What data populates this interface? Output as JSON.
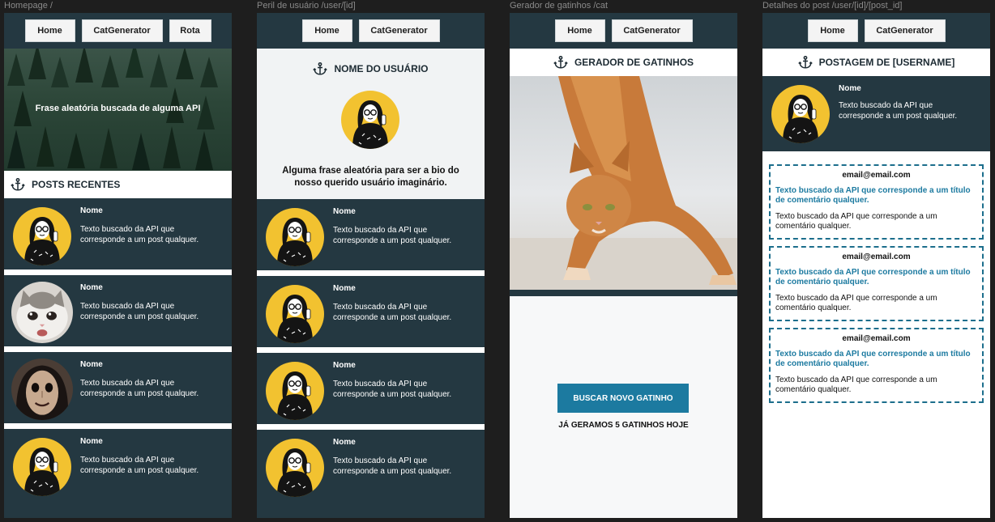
{
  "frames": {
    "home": {
      "label": "Homepage /"
    },
    "profile": {
      "label": "Peril de usuário /user/[id]"
    },
    "cat": {
      "label": "Gerador de gatinhos /cat"
    },
    "detail": {
      "label": "Detalhes do post /user/[id]/[post_id]"
    }
  },
  "nav": {
    "home": "Home",
    "catgen": "CatGenerator",
    "rota": "Rota"
  },
  "home": {
    "hero_text": "Frase aleatória buscada de alguma API",
    "section_title": "POSTS RECENTES",
    "posts": [
      {
        "name": "Nome",
        "text": "Texto buscado da API que corresponde a um post qualquer.",
        "avatar": "illustrated-woman"
      },
      {
        "name": "Nome",
        "text": "Texto buscado da API que corresponde a um post qualquer.",
        "avatar": "crying-kitten"
      },
      {
        "name": "Nome",
        "text": "Texto buscado da API que corresponde a um post qualquer.",
        "avatar": "meme-face"
      },
      {
        "name": "Nome",
        "text": "Texto buscado da API que corresponde a um post qualquer.",
        "avatar": "illustrated-woman"
      }
    ]
  },
  "profile": {
    "username": "NOME DO USUÁRIO",
    "bio": "Alguma frase aleatória para ser a bio do nosso querido usuário imaginário.",
    "posts": [
      {
        "name": "Nome",
        "text": "Texto buscado da API que corresponde a um post qualquer."
      },
      {
        "name": "Nome",
        "text": "Texto buscado da API que corresponde a um post qualquer."
      },
      {
        "name": "Nome",
        "text": "Texto buscado da API que corresponde a um post qualquer."
      },
      {
        "name": "Nome",
        "text": "Texto buscado da API que corresponde a um post qualquer."
      }
    ]
  },
  "cat": {
    "title": "GERADOR DE GATINHOS",
    "button": "BUSCAR NOVO GATINHO",
    "count": "JÁ GERAMOS 5 GATINHOS HOJE"
  },
  "detail": {
    "title": "POSTAGEM DE [USERNAME]",
    "post": {
      "name": "Nome",
      "text": "Texto buscado da API que corresponde a um post qualquer."
    },
    "comments": [
      {
        "email": "email@email.com",
        "title": "Texto buscado da API que corresponde a um título de comentário qualquer.",
        "text": "Texto buscado da API que corresponde a um comentário qualquer."
      },
      {
        "email": "email@email.com",
        "title": "Texto buscado da API que corresponde a um título de comentário qualquer.",
        "text": "Texto buscado da API que corresponde a um comentário qualquer."
      },
      {
        "email": "email@email.com",
        "title": "Texto buscado da API que corresponde a um título de comentário qualquer.",
        "text": "Texto buscado da API que corresponde a um comentário qualquer."
      }
    ]
  },
  "colors": {
    "dark": "#243841",
    "accent": "#1c7aa0",
    "avatar_bg": "#f2c230"
  }
}
